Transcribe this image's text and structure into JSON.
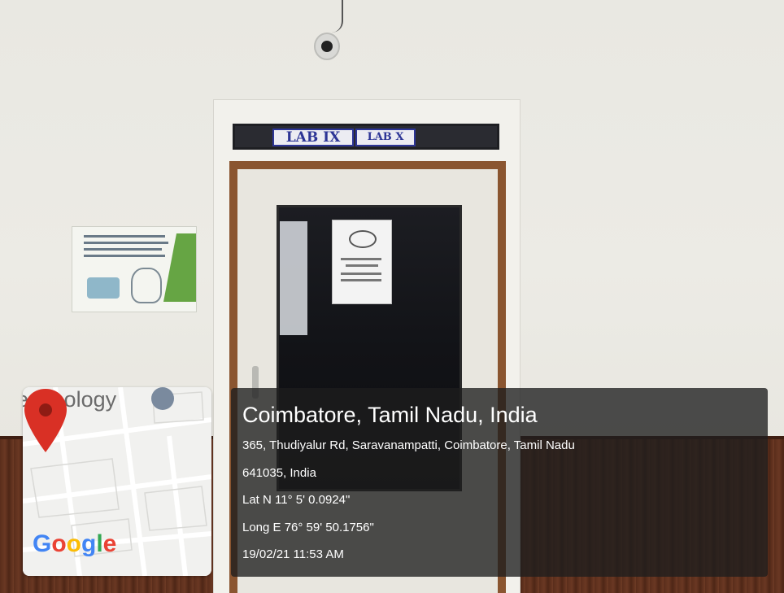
{
  "signs": {
    "lab_left": "LAB IX",
    "lab_right": "LAB X"
  },
  "map": {
    "label": "echnology",
    "brand": "Google",
    "pin_color": "#d93025"
  },
  "location": {
    "city": "Coimbatore, Tamil Nadu, India",
    "address_line1": "365, Thudiyalur Rd, Saravanampatti, Coimbatore, Tamil Nadu",
    "address_line2": "641035, India",
    "lat": "Lat N 11° 5' 0.0924\"",
    "long": "Long E 76° 59' 50.1756\"",
    "timestamp": "19/02/21 11:53 AM"
  }
}
